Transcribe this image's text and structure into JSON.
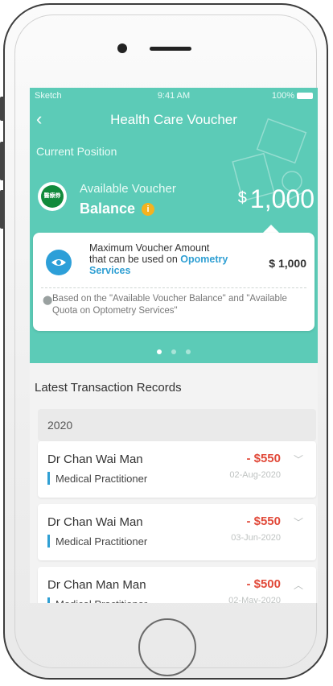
{
  "status_bar": {
    "carrier": "Sketch",
    "time": "9:41 AM",
    "battery": "100%"
  },
  "header": {
    "back_icon": "chevron-left-icon",
    "title": "Health Care Voucher"
  },
  "current_position_label": "Current Position",
  "balance": {
    "logo_text": "醫療券",
    "label_line1": "Available Voucher",
    "label_line2": "Balance",
    "currency": "$",
    "amount": "1,000"
  },
  "info_card": {
    "line1": "Maximum Voucher Amount",
    "line2_prefix": "that can be used on",
    "line2_highlight": "Opometry",
    "line3_highlight": "Services",
    "amount": "$ 1,000",
    "note": "Based on the \"Available Voucher Balance\" and \"Available Quota on Optometry Services\""
  },
  "pagination": {
    "count": 3,
    "active": 0
  },
  "transactions": {
    "heading": "Latest Transaction Records",
    "year": "2020",
    "records": [
      {
        "name": "Dr Chan Wai Man",
        "type": "Medical Practitioner",
        "amount": "- $550",
        "date": "02-Aug-2020",
        "expanded": false
      },
      {
        "name": "Dr Chan Wai Man",
        "type": "Medical Practitioner",
        "amount": "- $550",
        "date": "03-Jun-2020",
        "expanded": false
      },
      {
        "name": "Dr Chan Man Man",
        "type": "Medical Practitioner",
        "amount": "- $500",
        "date": "02-May-2020",
        "expanded": true
      }
    ]
  },
  "colors": {
    "teal": "#5ccbb7",
    "accent_blue": "#2f9fd3",
    "negative_red": "#e14a3a",
    "info_yellow": "#f5b21f"
  }
}
